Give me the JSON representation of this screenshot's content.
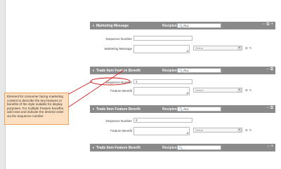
{
  "panels": [
    {
      "title": "Marketing Message",
      "recipient_label": "Recipient",
      "recipient_value": "ALL",
      "fields": [
        {
          "label": "Sequence Number",
          "value": ""
        },
        {
          "label": "Marketing Message",
          "value": "",
          "select": "Select"
        }
      ]
    },
    {
      "title": "Trade Item Feature Benefit",
      "recipient_label": "Recipient",
      "recipient_value": "ALL",
      "fields": [
        {
          "label": "Sequence Number",
          "value": "1"
        },
        {
          "label": "Feature Benefit",
          "value": "",
          "select": "Select"
        }
      ]
    },
    {
      "title": "Trade Item Feature Benefit",
      "recipient_label": "Recipient",
      "recipient_value": "ALL",
      "fields": [
        {
          "label": "Sequence Number",
          "value": "2"
        },
        {
          "label": "Feature Benefit",
          "value": "",
          "select": "Select"
        }
      ]
    },
    {
      "title": "Trade Item Feature Benefit",
      "recipient_label": "Recipient",
      "recipient_value": ""
    }
  ],
  "callout": {
    "text": "Element for consumer facing marketing content to describe the key features or benefits of the style suitable for display purposes. For multiple Feature benefits, add rows and indicate the desired order via the sequence number."
  },
  "colors": {
    "header_bg": "#8a8a8a",
    "callout_bg": "#fde0c2",
    "annotation_red": "#d01010"
  },
  "icons": {
    "header_controls": [
      "minus-icon",
      "copy-icon",
      "plus-icon"
    ],
    "search": "magnifier-icon",
    "row_tools": [
      "plus-circle-icon",
      "refresh-icon"
    ]
  }
}
